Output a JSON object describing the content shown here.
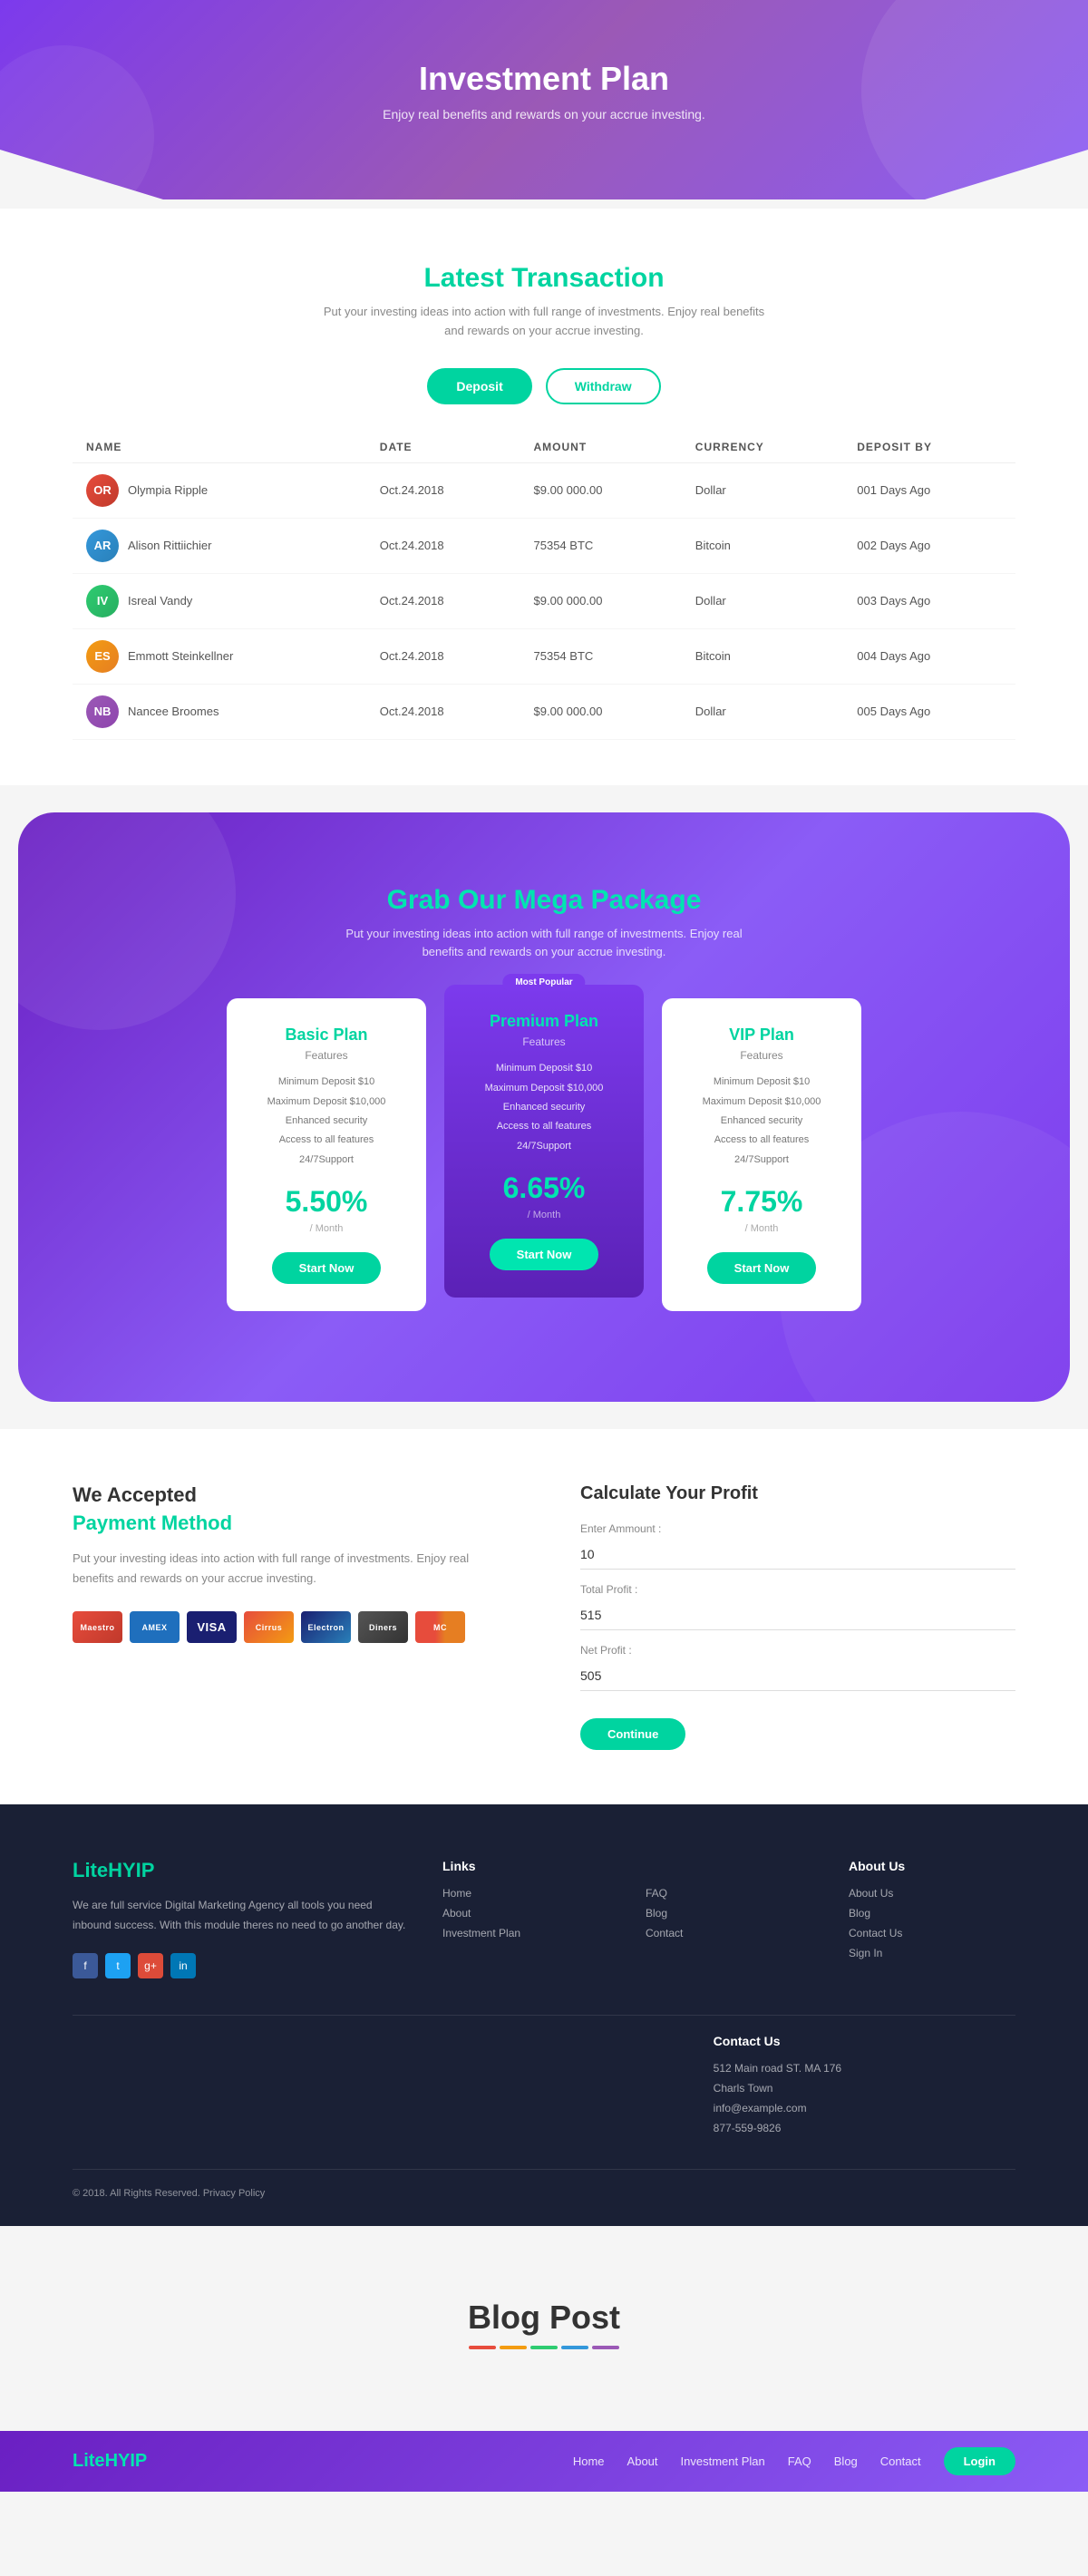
{
  "hero": {
    "title": "Investment Plan",
    "subtitle": "Enjoy real benefits and rewards on  your accrue investing."
  },
  "transaction": {
    "section_title": "Latest ",
    "section_title_highlight": "Transaction",
    "section_desc": "Put your investing ideas into action with full range of investments. Enjoy real benefits and rewards on your accrue investing.",
    "tab_deposit": "Deposit",
    "tab_withdraw": "Withdraw",
    "table_headers": [
      "NAME",
      "DATE",
      "AMOUNT",
      "CURRENCY",
      "DEPOSIT BY"
    ],
    "rows": [
      {
        "name": "Olympia Ripple",
        "initials": "OR",
        "date": "Oct.24.2018",
        "amount": "$9.00 000.00",
        "currency": "Dollar",
        "deposit_by": "001 Days Ago",
        "avatar_class": "av1"
      },
      {
        "name": "Alison Rittiichier",
        "initials": "AR",
        "date": "Oct.24.2018",
        "amount": "75354 BTC",
        "currency": "Bitcoin",
        "deposit_by": "002 Days Ago",
        "avatar_class": "av2"
      },
      {
        "name": "Isreal Vandy",
        "initials": "IV",
        "date": "Oct.24.2018",
        "amount": "$9.00 000.00",
        "currency": "Dollar",
        "deposit_by": "003 Days Ago",
        "avatar_class": "av3"
      },
      {
        "name": "Emmott Steinkellner",
        "initials": "ES",
        "date": "Oct.24.2018",
        "amount": "75354 BTC",
        "currency": "Bitcoin",
        "deposit_by": "004 Days Ago",
        "avatar_class": "av4"
      },
      {
        "name": "Nancee Broomes",
        "initials": "NB",
        "date": "Oct.24.2018",
        "amount": "$9.00 000.00",
        "currency": "Dollar",
        "deposit_by": "005 Days Ago",
        "avatar_class": "av5"
      }
    ]
  },
  "mega": {
    "title": "Grab Our ",
    "title_highlight": "Mega Package",
    "desc": "Put your investing ideas into action with full range of investments. Enjoy real benefits and rewards on your accrue investing.",
    "most_popular": "Most Popular",
    "plans": [
      {
        "name": "Basic Plan",
        "features_label": "Features",
        "featured": false,
        "features": [
          "Minimum Deposit $10",
          "Maximum Deposit $10,000",
          "Enhanced security",
          "Access to all features",
          "24/7Support"
        ],
        "rate": "5.50%",
        "period": "/ Month",
        "btn_label": "Start Now"
      },
      {
        "name": "Premium Plan",
        "features_label": "Features",
        "featured": true,
        "features": [
          "Minimum Deposit $10",
          "Maximum Deposit $10,000",
          "Enhanced security",
          "Access to all features",
          "24/7Support"
        ],
        "rate": "6.65%",
        "period": "/ Month",
        "btn_label": "Start Now"
      },
      {
        "name": "VIP Plan",
        "features_label": "Features",
        "featured": false,
        "features": [
          "Minimum Deposit $10",
          "Maximum Deposit $10,000",
          "Enhanced security",
          "Access to all features",
          "24/7Support"
        ],
        "rate": "7.75%",
        "period": "/ Month",
        "btn_label": "Start Now"
      }
    ]
  },
  "payment": {
    "we_accepted": "We Accepted",
    "payment_method": "Payment Method",
    "desc": "Put your investing ideas into action with full range of investments. Enjoy real benefits and rewards on your accrue investing.",
    "logos": [
      {
        "label": "Maestro",
        "class": "logo-maestro"
      },
      {
        "label": "AMEX",
        "class": "logo-amex"
      },
      {
        "label": "VISA",
        "class": "logo-visa"
      },
      {
        "label": "Cirrus",
        "class": "logo-cirrus"
      },
      {
        "label": "Electron",
        "class": "logo-electron"
      },
      {
        "label": "Diners",
        "class": "logo-diners"
      },
      {
        "label": "MC",
        "class": "logo-mc"
      }
    ]
  },
  "calculator": {
    "title": "Calculate Your Profit",
    "enter_amount_label": "Enter Ammount :",
    "enter_amount_value": "10",
    "total_profit_label": "Total Profit :",
    "total_profit_value": "515",
    "net_profit_label": "Net Profit :",
    "net_profit_value": "505",
    "continue_btn": "Continue"
  },
  "footer": {
    "logo_lite": "Lite",
    "logo_hyip": "HYIP",
    "about": "We are full service Digital Marketing Agency all tools you need inbound success. With this module theres no need to go another day.",
    "social": [
      "f",
      "t",
      "g+",
      "in"
    ],
    "copyright": "© 2018. All Rights Reserved. Privacy Policy",
    "links_title": "Links",
    "links": [
      {
        "label": "Home"
      },
      {
        "label": "About"
      },
      {
        "label": "Investment Plan"
      },
      {
        "label": "FAQ"
      },
      {
        "label": "Blog"
      },
      {
        "label": "Contact"
      }
    ],
    "about_title": "About Us",
    "about_links": [
      {
        "label": "About Us"
      },
      {
        "label": "Blog"
      },
      {
        "label": "Contact Us"
      },
      {
        "label": "Sign In"
      }
    ],
    "contact_title": "Contact Us",
    "contact_address": "512 Main road ST. MA 176",
    "contact_city": "Charls Town",
    "contact_email": "info@example.com",
    "contact_phone": "877-559-9826"
  },
  "blog": {
    "title": "Blog Post",
    "underline_colors": [
      "#e74c3c",
      "#f39c12",
      "#2ecc71",
      "#3498db",
      "#9b59b6"
    ]
  },
  "navbar": {
    "logo_lite": "Lite",
    "logo_hyip": "HYIP",
    "links": [
      "Home",
      "About",
      "Investment Plan",
      "FAQ",
      "Blog",
      "Contact"
    ],
    "login_btn": "Login"
  }
}
